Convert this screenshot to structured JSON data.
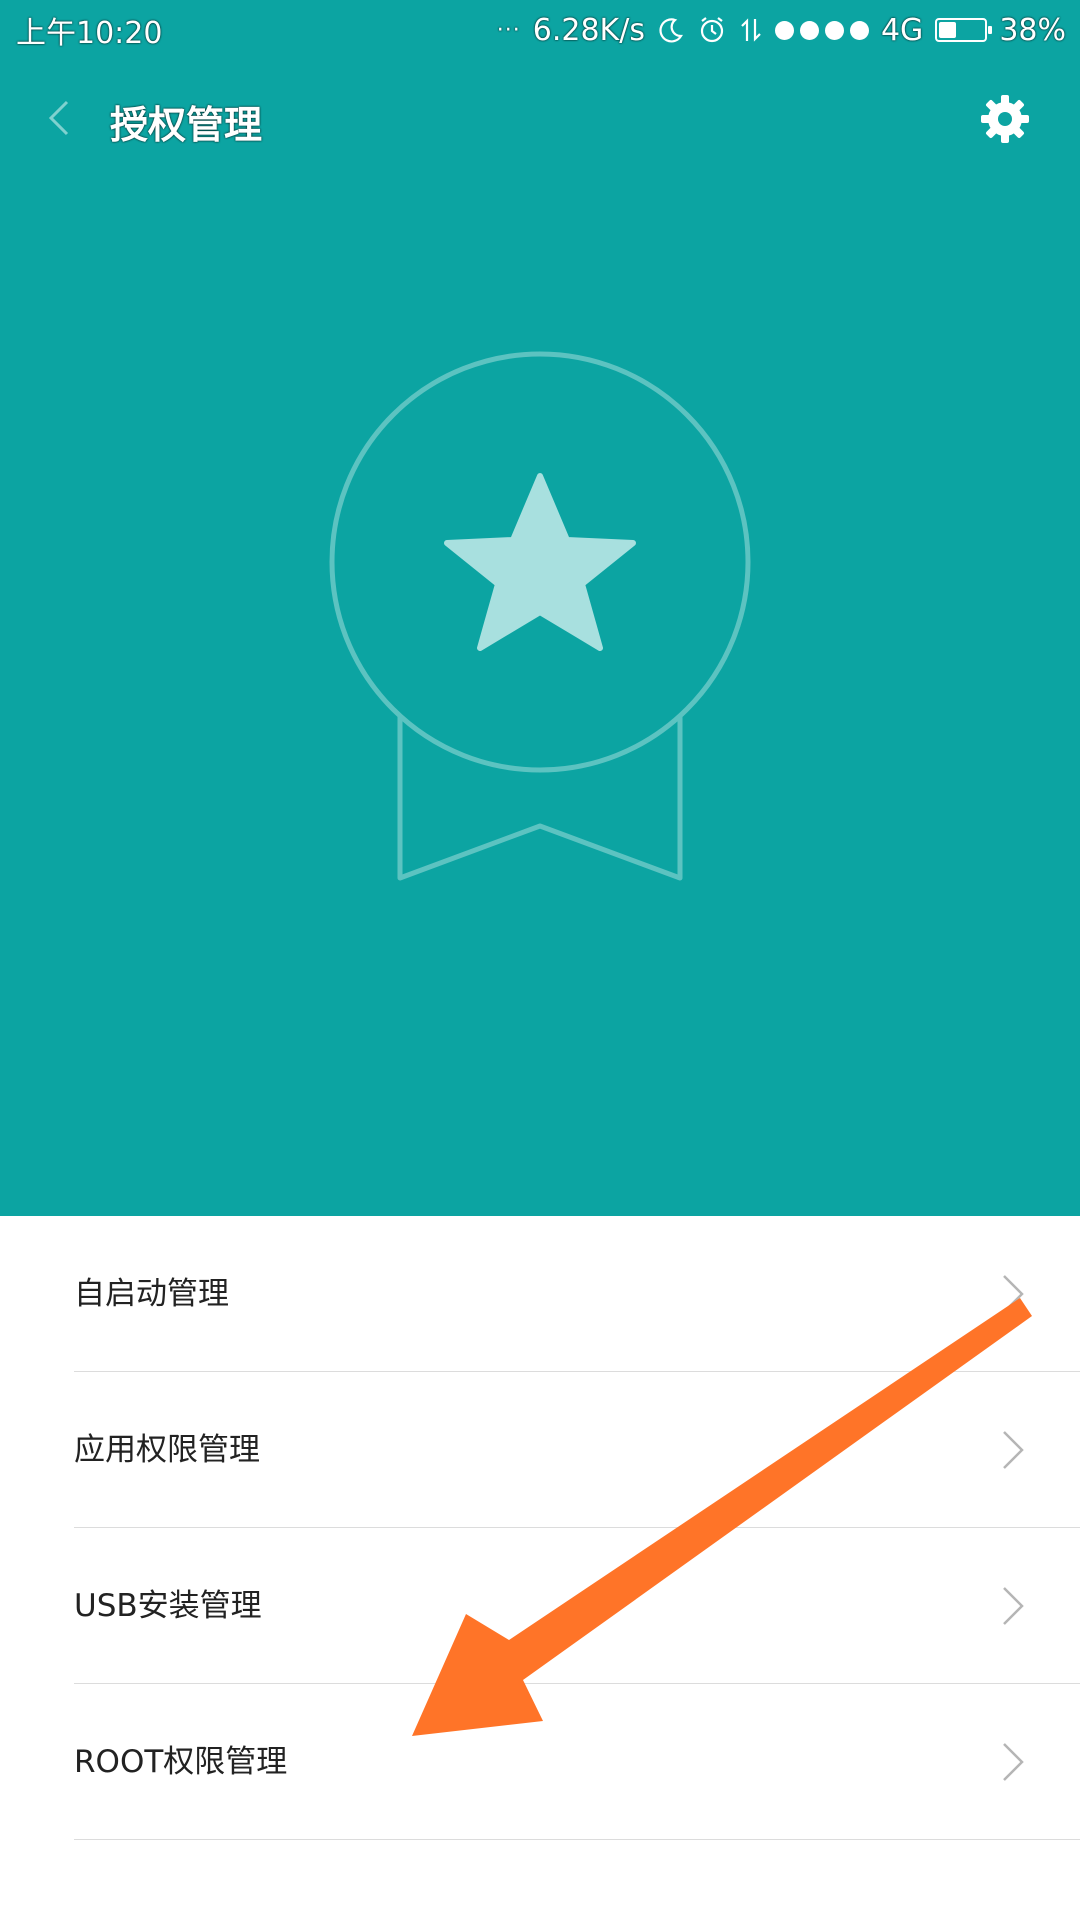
{
  "status_bar": {
    "time": "上午10:20",
    "more_indicator": "···",
    "net_speed": "6.28K/s",
    "icons": [
      "moon-icon",
      "alarm-icon",
      "data-arrows-icon",
      "signal-dots-icon"
    ],
    "network": "4G",
    "battery_level": 0.38,
    "battery_percent": "38%"
  },
  "header": {
    "back_icon": "chevron-left-icon",
    "title": "授权管理",
    "settings_icon": "gear-icon"
  },
  "hero": {
    "icon": "medal-star-icon",
    "background": "#0ca4a2",
    "icon_color": "#a8e0df"
  },
  "menu": {
    "items": [
      {
        "label": "自启动管理"
      },
      {
        "label": "应用权限管理"
      },
      {
        "label": "USB安装管理"
      },
      {
        "label": "ROOT权限管理"
      }
    ],
    "chevron_icon": "chevron-right-icon"
  },
  "annotation": {
    "icon": "orange-arrow-annotation",
    "color": "#ff7428",
    "points_to": "ROOT权限管理"
  }
}
